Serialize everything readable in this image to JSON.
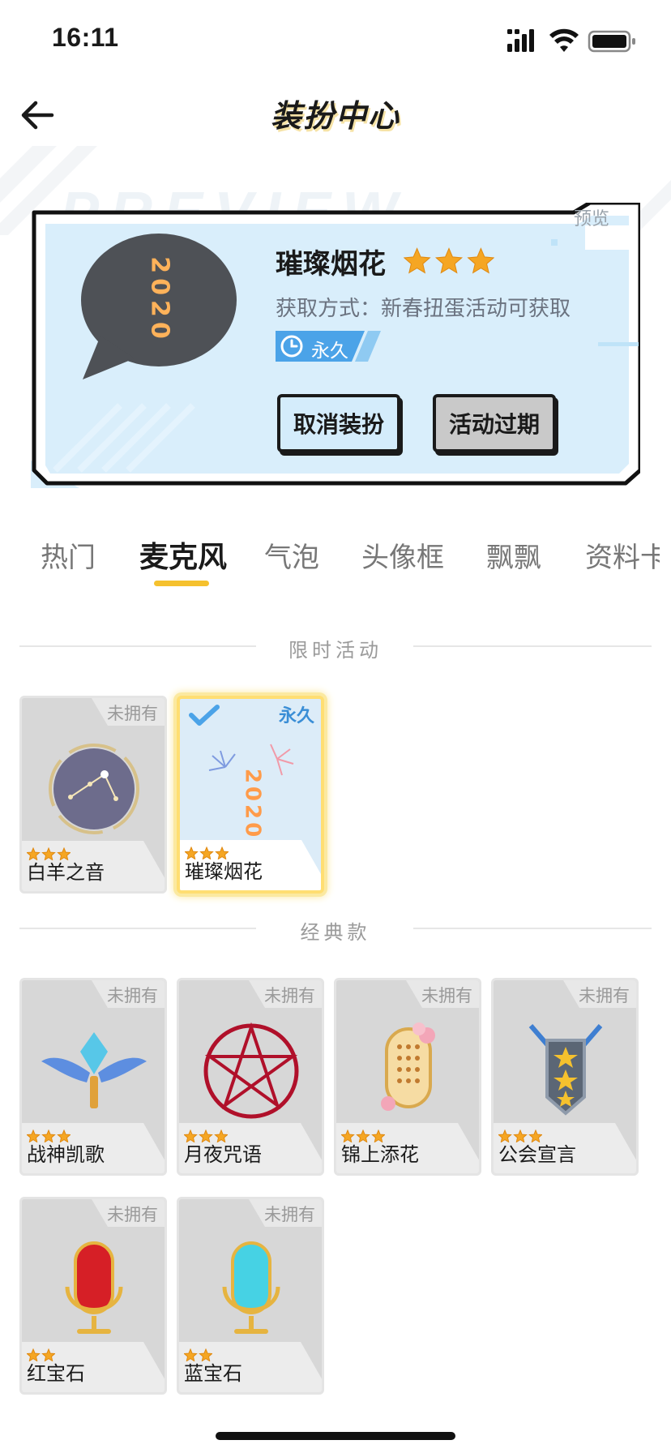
{
  "status_bar": {
    "time": "16:11"
  },
  "header": {
    "title": "装扮中心"
  },
  "preview": {
    "corner_label": "预览",
    "bubble_text": "2020",
    "item_name": "璀璨烟花",
    "stars": 3,
    "obtain_text": "获取方式：新春扭蛋活动可获取",
    "duration_tag": "永久",
    "buttons": {
      "cancel": "取消装扮",
      "expired": "活动过期"
    }
  },
  "tabs": [
    {
      "label": "热门"
    },
    {
      "label": "麦克风",
      "active": true
    },
    {
      "label": "气泡"
    },
    {
      "label": "头像框"
    },
    {
      "label": "飘飘"
    },
    {
      "label": "资料卡"
    }
  ],
  "sections": {
    "limited": {
      "title": "限时活动",
      "items": [
        {
          "name": "白羊之音",
          "stars": 3,
          "tag": "未拥有",
          "icon": "aries-constellation-icon"
        },
        {
          "name": "璀璨烟花",
          "stars": 3,
          "tag": "永久",
          "icon": "fireworks-2020-icon",
          "selected": true
        }
      ]
    },
    "classic": {
      "title": "经典款",
      "items": [
        {
          "name": "战神凯歌",
          "stars": 3,
          "tag": "未拥有",
          "icon": "winged-crystal-mic-icon"
        },
        {
          "name": "月夜咒语",
          "stars": 3,
          "tag": "未拥有",
          "icon": "pentagram-icon"
        },
        {
          "name": "锦上添花",
          "stars": 3,
          "tag": "未拥有",
          "icon": "flower-mic-icon"
        },
        {
          "name": "公会宣言",
          "stars": 3,
          "tag": "未拥有",
          "icon": "guild-shield-icon"
        },
        {
          "name": "红宝石",
          "stars": 2,
          "tag": "未拥有",
          "icon": "ruby-mic-icon"
        },
        {
          "name": "蓝宝石",
          "stars": 2,
          "tag": "未拥有",
          "icon": "sapphire-mic-icon"
        }
      ]
    }
  },
  "colors": {
    "accent": "#f5c12e",
    "card_bg": "#d9eefb",
    "tag_blue": "#4ba3e8"
  }
}
